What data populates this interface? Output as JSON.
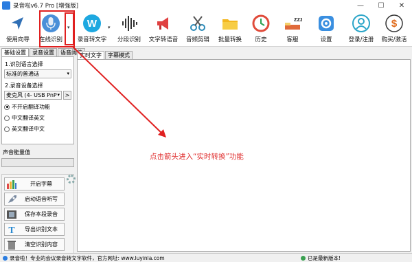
{
  "window": {
    "title": "录音啦v6.7 Pro [增强版]",
    "controls": [
      "—",
      "☐",
      "✕"
    ]
  },
  "toolbar": {
    "items": [
      {
        "id": "guide",
        "label": "使用向导",
        "icon": "navigation-arrow-icon"
      },
      {
        "id": "online",
        "label": "在线识别",
        "icon": "microphone-icon"
      },
      {
        "id": "rec2text",
        "label": "录音转文字",
        "icon": "w-logo-icon"
      },
      {
        "id": "segment",
        "label": "分段识别",
        "icon": "waveform-icon"
      },
      {
        "id": "text2voice",
        "label": "文字转语音",
        "icon": "megaphone-icon"
      },
      {
        "id": "cut",
        "label": "音频剪辑",
        "icon": "scissors-icon"
      },
      {
        "id": "batch",
        "label": "批量转换",
        "icon": "folder-icon"
      },
      {
        "id": "history",
        "label": "历史",
        "icon": "clock-icon"
      },
      {
        "id": "sleep",
        "label": "客服",
        "icon": "sleep-icon"
      },
      {
        "id": "settings",
        "label": "设置",
        "icon": "gear-icon"
      },
      {
        "id": "login",
        "label": "登录/注册",
        "icon": "user-icon"
      },
      {
        "id": "buy",
        "label": "购买/激活",
        "icon": "dollar-icon"
      }
    ],
    "dropdown_arrow": "▾"
  },
  "left": {
    "tabs": [
      "基础设置",
      "录音设置",
      "语音阈值"
    ],
    "section1_label": "1.识别语言选择",
    "language_value": "标准的普通话",
    "section2_label": "2.录音设备选择",
    "device_value": "麦克风 (4- USB PnP",
    "device_btn": ">",
    "radios": [
      {
        "label": "不开启翻译功能",
        "checked": true
      },
      {
        "label": "中文翻译英文",
        "checked": false
      },
      {
        "label": "英文翻译中文",
        "checked": false
      }
    ],
    "volume_label": "声音能量值",
    "buttons": [
      {
        "label": "开启字幕",
        "icon": "bar-chart-icon"
      },
      {
        "label": "启动语音听写",
        "icon": "rocket-icon"
      },
      {
        "label": "保存本段录音",
        "icon": "film-icon"
      },
      {
        "label": "导出识别文本",
        "icon": "text-t-icon"
      },
      {
        "label": "清空识别内容",
        "icon": "trash-icon"
      }
    ]
  },
  "right": {
    "tabs": [
      "实时文字",
      "字幕模式"
    ]
  },
  "annotation": "点击箭头进入“实时转换”功能",
  "status": {
    "left": "录音啦！专业的会议录音转文字软件，官方网址: www.luyinla.com",
    "right": "已是最新版本!"
  },
  "colors": {
    "highlight": "#e02020",
    "annotation": "#e03030"
  }
}
